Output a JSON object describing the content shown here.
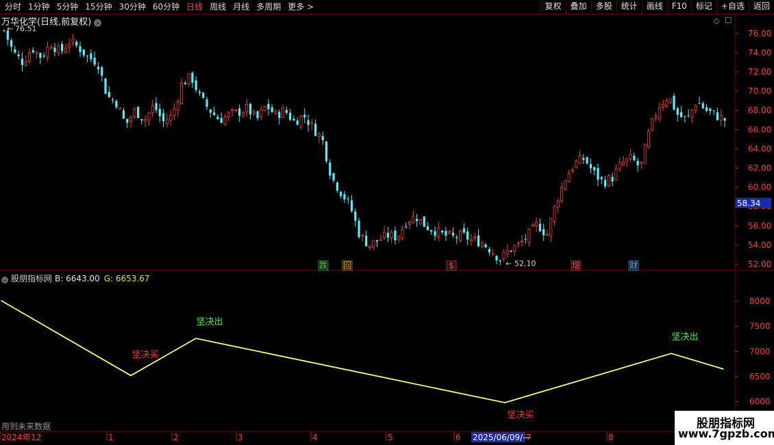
{
  "toolbar": {
    "periods": [
      "分时",
      "1分钟",
      "5分钟",
      "15分钟",
      "30分钟",
      "60分钟",
      "日线",
      "周线",
      "月线",
      "多周期",
      "更多 >"
    ],
    "active_period": "日线",
    "actions": [
      "复权",
      "叠加",
      "多股",
      "统计",
      "画线",
      "F10",
      "+自选",
      "返回"
    ],
    "mark_label": "标记"
  },
  "stock": {
    "title": "万华化学(日线,前复权)"
  },
  "price_axis": {
    "ticks": [
      "76.00",
      "74.00",
      "72.00",
      "70.00",
      "68.00",
      "66.00",
      "64.00",
      "62.00",
      "60.00",
      "58.00",
      "56.00",
      "54.00",
      "52.00"
    ],
    "current_price": "58.34",
    "high_label": "76.51",
    "low_label": "52.10"
  },
  "event_markers": [
    {
      "text": "跌",
      "color": "#2bd84a"
    },
    {
      "text": "回",
      "color": "#e8a000"
    },
    {
      "text": "$",
      "color": "#ff3b3b"
    },
    {
      "text": "增",
      "color": "#ff3b3b"
    },
    {
      "text": "财",
      "color": "#4db3ff"
    }
  ],
  "indicator": {
    "name": "股朋指标网",
    "b_label": "B: 6643.00",
    "g_label": "G: 6653.67",
    "ticks": [
      "8000",
      "7500",
      "7000",
      "6500",
      "6000"
    ],
    "signals": [
      {
        "text": "坚决买",
        "color": "#ff3030"
      },
      {
        "text": "坚决出",
        "color": "#30ff30"
      },
      {
        "text": "坚决买",
        "color": "#ff3030"
      },
      {
        "text": "坚决出",
        "color": "#30ff30"
      }
    ],
    "note": "用到未来数据"
  },
  "date_axis": {
    "labels": [
      "2024年",
      "12",
      "1",
      "2",
      "3",
      "4",
      "5",
      "6",
      "2025/06/09/—",
      "7",
      "8"
    ]
  },
  "watermark": {
    "name": "股朋指标网",
    "url": "www.7gpzb.com"
  },
  "chart_data": [
    {
      "type": "candlestick",
      "title": "万华化学(日线,前复权)",
      "ylim": [
        51.5,
        77.2
      ],
      "approx_close_path": [
        76.3,
        74.0,
        73.0,
        74.5,
        73.5,
        75.0,
        74.0,
        75.2,
        74.5,
        73.5,
        73.0,
        69.5,
        68.8,
        66.5,
        68.0,
        67.0,
        68.5,
        66.8,
        67.5,
        70.8,
        71.5,
        69.2,
        68.0,
        67.0,
        67.5,
        67.8,
        68.2,
        67.0,
        68.5,
        67.5,
        68.0,
        66.8,
        67.5,
        66.2,
        65.0,
        61.0,
        59.5,
        58.0,
        55.0,
        54.0,
        54.5,
        55.0,
        54.8,
        56.5,
        57.0,
        56.0,
        55.5,
        55.0,
        54.8,
        55.0,
        54.5,
        54.3,
        53.5,
        52.5,
        53.5,
        54.0,
        55.0,
        56.2,
        55.0,
        58.5,
        61.0,
        62.5,
        63.0,
        61.5,
        60.5,
        61.0,
        62.5,
        63.0,
        62.0,
        66.0,
        68.5,
        69.5,
        67.5,
        67.0,
        69.0,
        68.0,
        67.5,
        67.0
      ],
      "high": 76.51,
      "low": 52.1,
      "last": 58.34
    },
    {
      "type": "line",
      "series": [
        {
          "name": "",
          "x": [
            "start",
            "seg1",
            "seg2",
            "seg3",
            "seg4",
            "end"
          ],
          "values": [
            8010,
            6520,
            7260,
            5980,
            6960,
            6650
          ]
        }
      ],
      "ylim": [
        5750,
        8300
      ]
    }
  ]
}
